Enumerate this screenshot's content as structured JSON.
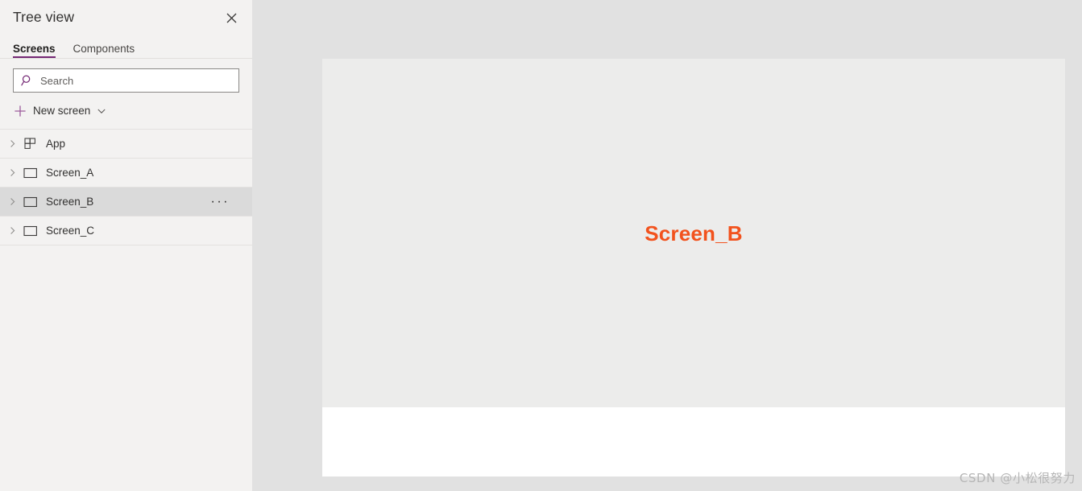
{
  "panel": {
    "title": "Tree view",
    "close_icon": "close-icon",
    "tabs": [
      {
        "label": "Screens",
        "active": true
      },
      {
        "label": "Components",
        "active": false
      }
    ],
    "search": {
      "icon": "search-icon",
      "placeholder": "Search",
      "value": ""
    },
    "new_screen": {
      "icon": "plus-icon",
      "label": "New screen",
      "chevron": "chevron-down-icon"
    },
    "tree": [
      {
        "label": "App",
        "icon": "app-grid-icon",
        "expanded": false,
        "selected": false,
        "overflow": ""
      },
      {
        "label": "Screen_A",
        "icon": "screen-rect-icon",
        "expanded": false,
        "selected": false,
        "overflow": ""
      },
      {
        "label": "Screen_B",
        "icon": "screen-rect-icon",
        "expanded": false,
        "selected": true,
        "overflow": "···"
      },
      {
        "label": "Screen_C",
        "icon": "screen-rect-icon",
        "expanded": false,
        "selected": false,
        "overflow": ""
      }
    ]
  },
  "canvas": {
    "screen_label": "Screen_B"
  },
  "watermark": "CSDN @小松很努力",
  "colors": {
    "accent_purple": "#742774",
    "label_orange": "#f2521d",
    "workspace_bg": "#e1e1e1",
    "canvas_screen_bg": "#ececeb",
    "sidebar_bg": "#f3f2f1",
    "row_selected_bg": "#dadada"
  }
}
